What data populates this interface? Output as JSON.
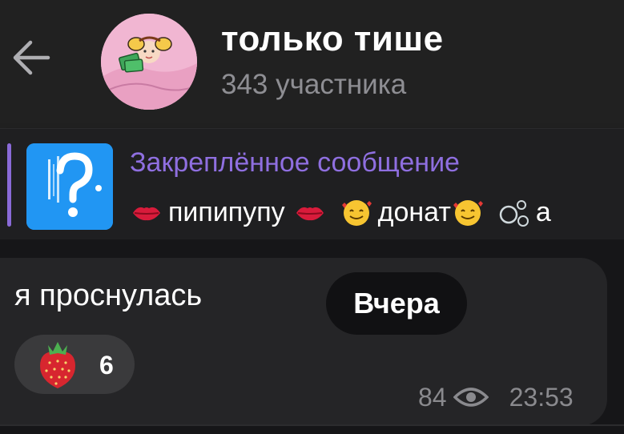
{
  "header": {
    "title": "только тише",
    "subtitle": "343 участника",
    "back_icon": "arrow-left-icon",
    "avatar_icon": "group-avatar"
  },
  "pinned": {
    "label": "Закреплённое сообщение",
    "preview_segments": [
      {
        "emoji": "kiss-lips-icon",
        "text": "пипипупу"
      },
      {
        "emoji": "kiss-lips-icon",
        "text": ""
      },
      {
        "emoji": "smiling-face-hearts-icon",
        "text": "донат"
      },
      {
        "emoji": "smiling-face-hearts-icon",
        "text": ""
      },
      {
        "emoji": "bubbles-icon",
        "text": "а"
      }
    ],
    "thumb_icon": "question-mark-icon",
    "label_color": "#8f6fe0",
    "thumb_color": "#2196f3"
  },
  "message": {
    "text": "я проснулась",
    "reaction": {
      "emoji": "strawberry-icon",
      "count": "6"
    },
    "views": "84",
    "time": "23:53"
  },
  "date_pill": "Вчера",
  "colors": {
    "background": "#1d1d1f",
    "header": "#212121",
    "bubble": "#252527",
    "secondary_text": "#8e8e93"
  }
}
